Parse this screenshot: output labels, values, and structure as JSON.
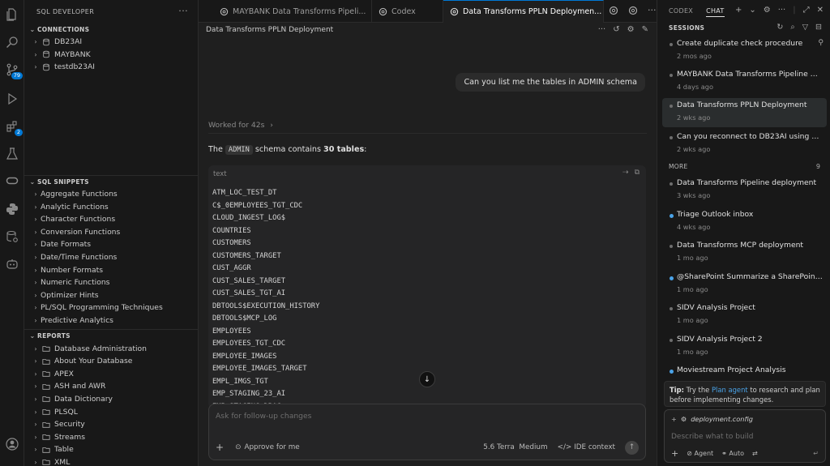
{
  "sidebar": {
    "title": "SQL DEVELOPER",
    "connections": {
      "header": "CONNECTIONS",
      "items": [
        "DB23AI",
        "MAYBANK",
        "testdb23AI"
      ]
    },
    "snippets": {
      "header": "SQL SNIPPETS",
      "items": [
        "Aggregate Functions",
        "Analytic Functions",
        "Character Functions",
        "Conversion Functions",
        "Date Formats",
        "Date/Time Functions",
        "Number Formats",
        "Numeric Functions",
        "Optimizer Hints",
        "PL/SQL Programming Techniques",
        "Predictive Analytics"
      ]
    },
    "reports": {
      "header": "REPORTS",
      "items": [
        "Database Administration",
        "About Your Database",
        "APEX",
        "ASH and AWR",
        "Data Dictionary",
        "PLSQL",
        "Security",
        "Streams",
        "Table",
        "XML"
      ]
    }
  },
  "activity": {
    "scm_badge": "79",
    "ext_badge": "2"
  },
  "tabs": [
    {
      "label": "MAYBANK Data Transforms Pipeli..."
    },
    {
      "label": "Codex"
    },
    {
      "label": "Data Transforms PPLN Deploymen..."
    }
  ],
  "editor": {
    "title": "Data Transforms PPLN Deployment",
    "user_message": "Can you list me the tables in ADMIN schema",
    "worked": "Worked for 42s",
    "summary_pre": "The",
    "summary_code": "ADMIN",
    "summary_mid": "schema contains",
    "summary_bold": "30 tables",
    "summary_end": ":",
    "code_lang": "text",
    "tables": [
      "ATM_LOC_TEST_DT",
      "C$_0EMPLOYEES_TGT_CDC",
      "CLOUD_INGEST_LOG$",
      "COUNTRIES",
      "CUSTOMERS",
      "CUSTOMERS_TARGET",
      "CUST_AGGR",
      "CUST_SALES_TARGET",
      "CUST_SALES_TGT_AI",
      "DBTOOLS$EXECUTION_HISTORY",
      "DBTOOLS$MCP_LOG",
      "EMPLOYEES",
      "EMPLOYEES_TGT_CDC",
      "EMPLOYEE_IMAGES",
      "EMPLOYEE_IMAGES_TARGET",
      "EMPL_IMGS_TGT",
      "EMP_STAGING_23_AI",
      "EMP_STAGING_DRAG"
    ],
    "input_placeholder": "Ask for follow-up changes",
    "approve_label": "Approve for me",
    "model_label": "5.6 Terra",
    "effort_label": "Medium",
    "ide_context_label": "IDE context"
  },
  "chat": {
    "tab_codex": "CODEX",
    "tab_chat": "CHAT",
    "sessions_header": "SESSIONS",
    "sessions": [
      {
        "title": "Create duplicate check procedure",
        "date": "2 mos ago"
      },
      {
        "title": "MAYBANK Data Transforms Pipeline Aut...",
        "date": "4 days ago"
      },
      {
        "title": "Data Transforms PPLN Deployment",
        "date": "2 wks ago"
      },
      {
        "title": "Can you reconnect to DB23AI using sql...",
        "date": "2 wks ago"
      }
    ],
    "more_header": "MORE",
    "more_count": "9",
    "more_sessions": [
      {
        "title": "Data Transforms Pipeline deployment",
        "date": "3 wks ago"
      },
      {
        "title": "Triage Outlook inbox",
        "date": "4 wks ago"
      },
      {
        "title": "Data Transforms MCP deployment",
        "date": "1 mo ago"
      },
      {
        "title": "@SharePoint Summarize a SharePoint...",
        "date": "1 mo ago"
      },
      {
        "title": "SIDV Analysis Project",
        "date": "1 mo ago"
      },
      {
        "title": "SIDV Analysis Project 2",
        "date": "1 mo ago"
      },
      {
        "title": "Moviestream Project Analysis",
        "date": ""
      }
    ],
    "tip_label": "Tip:",
    "tip_pre": "Try the",
    "tip_link": "Plan agent",
    "tip_post": "to research and plan before implementing changes.",
    "context_file": "deployment.config",
    "input_placeholder": "Describe what to build",
    "agent_label": "Agent",
    "auto_label": "Auto"
  }
}
